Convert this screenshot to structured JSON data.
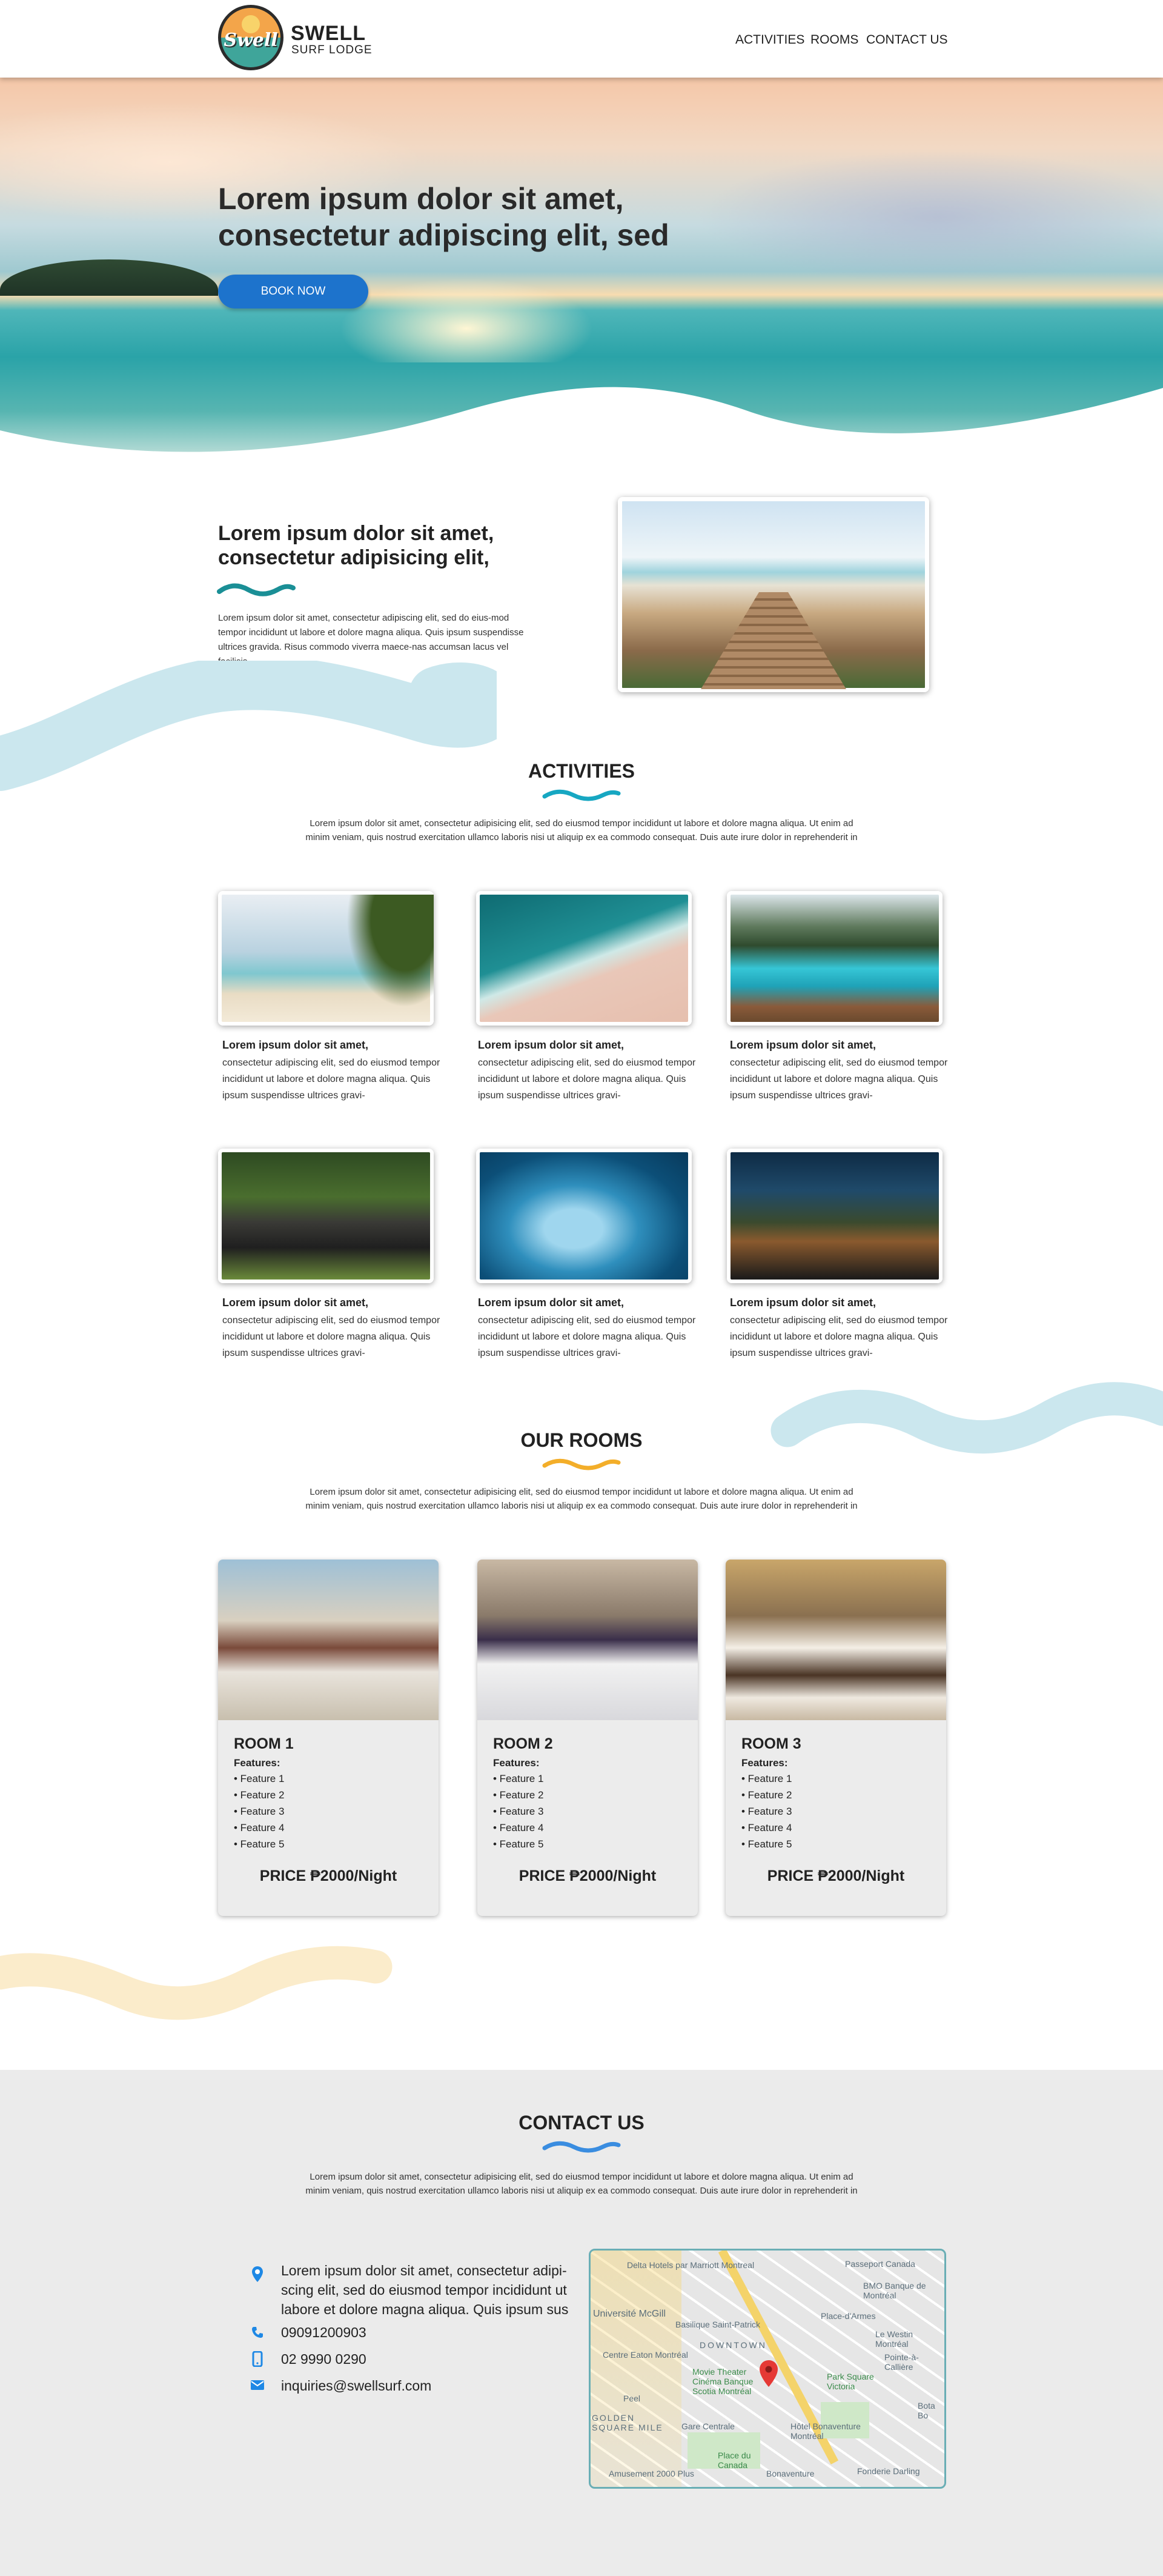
{
  "brand": {
    "script": "Swell",
    "title": "SWELL",
    "subtitle": "SURF LODGE"
  },
  "nav": {
    "items": [
      "ACTIVITIES",
      "ROOMS",
      "CONTACT US"
    ]
  },
  "hero": {
    "title_line1": "Lorem ipsum dolor sit amet,",
    "title_line2": "consectetur adipiscing elit, sed",
    "button": "BOOK NOW"
  },
  "intro": {
    "title_line1": "Lorem ipsum dolor sit amet,",
    "title_line2": "consectetur adipisicing elit,",
    "text": "Lorem ipsum dolor sit amet, consectetur adipiscing elit, sed do eius-mod tempor incididunt ut labore et dolore magna aliqua. Quis ipsum suspendisse ultrices gravida. Risus commodo viverra maece-nas accumsan lacus vel facilisis."
  },
  "activities": {
    "title": "ACTIVITIES",
    "text_line1": "Lorem ipsum dolor sit amet, consectetur adipisicing elit, sed do eiusmod tempor incididunt ut labore et dolore magna aliqua. Ut enim ad",
    "text_line2": "minim veniam, quis nostrud exercitation ullamco laboris nisi ut aliquip ex ea commodo consequat. Duis aute irure dolor in reprehenderit in",
    "cards": [
      {
        "heading": "Lorem ipsum dolor sit amet,",
        "text": "consectetur adipiscing elit, sed do eiusmod tempor incididunt ut labore et dolore magna aliqua. Quis ipsum suspendisse ultrices gravi-"
      },
      {
        "heading": "Lorem ipsum dolor sit amet,",
        "text": "consectetur adipiscing elit, sed do eiusmod tempor incididunt ut labore et dolore magna aliqua. Quis ipsum suspendisse ultrices gravi-"
      },
      {
        "heading": "Lorem ipsum dolor sit amet,",
        "text": "consectetur adipiscing elit, sed do eiusmod tempor incididunt ut labore et dolore magna aliqua. Quis ipsum suspendisse ultrices gravi-"
      },
      {
        "heading": "Lorem ipsum dolor sit amet,",
        "text": "consectetur adipiscing elit, sed do eiusmod tempor incididunt ut labore et dolore magna aliqua. Quis ipsum suspendisse ultrices gravi-"
      },
      {
        "heading": "Lorem ipsum dolor sit amet,",
        "text": "consectetur adipiscing elit, sed do eiusmod tempor incididunt ut labore et dolore magna aliqua. Quis ipsum suspendisse ultrices gravi-"
      },
      {
        "heading": "Lorem ipsum dolor sit amet,",
        "text": "consectetur adipiscing elit, sed do eiusmod tempor incididunt ut labore et dolore magna aliqua. Quis ipsum suspendisse ultrices gravi-"
      }
    ]
  },
  "rooms": {
    "title": "OUR ROOMS",
    "text_line1": "Lorem ipsum dolor sit amet, consectetur adipisicing elit, sed do eiusmod tempor incididunt ut labore et dolore magna aliqua. Ut enim ad",
    "text_line2": "minim veniam, quis nostrud exercitation ullamco laboris nisi ut aliquip ex ea commodo consequat. Duis aute irure dolor in reprehenderit in",
    "features_label": "Features:",
    "cards": [
      {
        "name": "ROOM 1",
        "features": [
          "• Feature 1",
          "• Feature 2",
          "• Feature 3",
          "• Feature 4",
          "• Feature 5"
        ],
        "price": "PRICE ₱2000/Night"
      },
      {
        "name": "ROOM 2",
        "features": [
          "• Feature 1",
          "• Feature 2",
          "• Feature 3",
          "• Feature 4",
          "• Feature 5"
        ],
        "price": "PRICE ₱2000/Night"
      },
      {
        "name": "ROOM 3",
        "features": [
          "• Feature 1",
          "• Feature 2",
          "• Feature 3",
          "• Feature 4",
          "• Feature 5"
        ],
        "price": "PRICE ₱2000/Night"
      }
    ]
  },
  "contact": {
    "title": "CONTACT US",
    "text_line1": "Lorem ipsum dolor sit amet, consectetur adipisicing elit, sed do eiusmod tempor incididunt ut labore et dolore magna aliqua. Ut enim ad",
    "text_line2": "minim veniam, quis nostrud exercitation ullamco laboris nisi ut aliquip ex ea commodo consequat. Duis aute irure dolor in reprehenderit in",
    "address_line1": "Lorem ipsum dolor sit amet, consectetur adipi-",
    "address_line2": "scing elit, sed do eiusmod tempor incididunt ut",
    "address_line3": "labore et dolore magna aliqua. Quis ipsum sus",
    "phone": "09091200903",
    "mobile": "02 9990 0290",
    "email": "inquiries@swellsurf.com",
    "map_labels": [
      "Delta Hotels par Marriott Montreal",
      "Passeport Canada",
      "BMO Banque de Montréal",
      "Université McGill",
      "Basilique Saint-Patrick",
      "Place-d'Armes",
      "Le Westin Montréal",
      "Centre Eaton Montréal",
      "DOWNTOWN",
      "Pointe-à-Callière",
      "Peel",
      "Movie Theater Cinéma Banque Scotia Montréal",
      "Park Square Victoria",
      "Bota Bo",
      "GOLDEN SQUARE MILE",
      "Gare Centrale",
      "Hôtel Bonaventure Montréal",
      "Place du Canada",
      "Bonaventure",
      "Amusement 2000 Plus",
      "Fonderie Darling"
    ]
  },
  "colors": {
    "accent_blue": "#1d73cc",
    "wave_teal": "#1a8f96",
    "wave_yellow": "#f3ae2a",
    "wave_blue": "#3a8de0",
    "decor_light_blue": "#cbe7ee",
    "decor_light_yellow": "#fbeccb",
    "contact_bg": "#ebebeb"
  },
  "icons": [
    "location-pin-icon",
    "phone-icon",
    "mobile-icon",
    "email-icon",
    "map-pin-icon"
  ]
}
